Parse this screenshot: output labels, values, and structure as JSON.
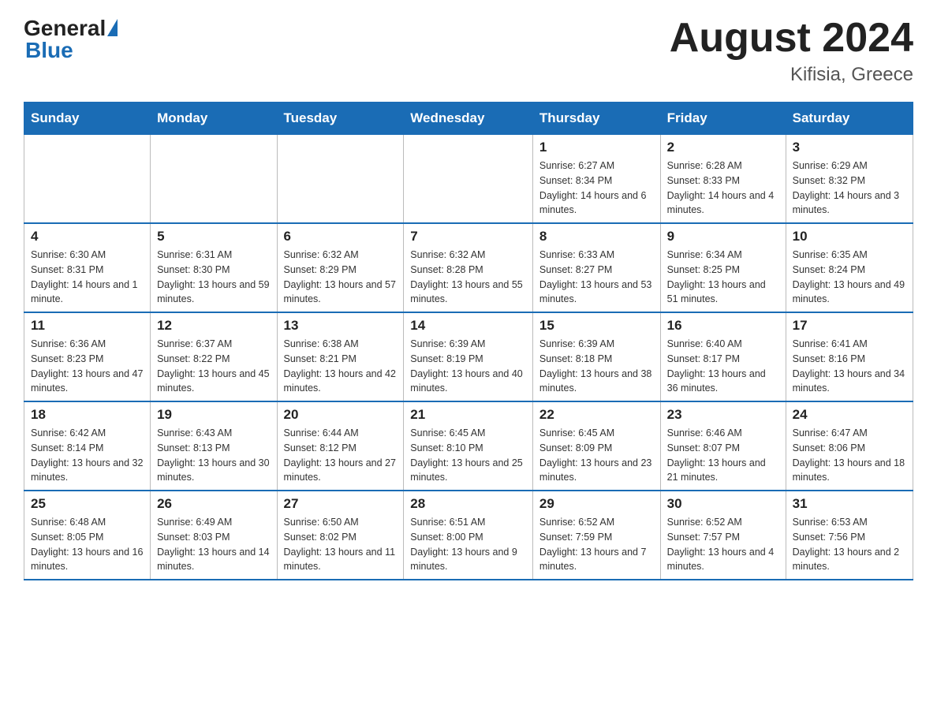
{
  "header": {
    "logo": {
      "general": "General",
      "blue": "Blue"
    },
    "title": "August 2024",
    "subtitle": "Kifisia, Greece"
  },
  "weekdays": [
    "Sunday",
    "Monday",
    "Tuesday",
    "Wednesday",
    "Thursday",
    "Friday",
    "Saturday"
  ],
  "weeks": [
    [
      {
        "day": "",
        "info": ""
      },
      {
        "day": "",
        "info": ""
      },
      {
        "day": "",
        "info": ""
      },
      {
        "day": "",
        "info": ""
      },
      {
        "day": "1",
        "info": "Sunrise: 6:27 AM\nSunset: 8:34 PM\nDaylight: 14 hours and 6 minutes."
      },
      {
        "day": "2",
        "info": "Sunrise: 6:28 AM\nSunset: 8:33 PM\nDaylight: 14 hours and 4 minutes."
      },
      {
        "day": "3",
        "info": "Sunrise: 6:29 AM\nSunset: 8:32 PM\nDaylight: 14 hours and 3 minutes."
      }
    ],
    [
      {
        "day": "4",
        "info": "Sunrise: 6:30 AM\nSunset: 8:31 PM\nDaylight: 14 hours and 1 minute."
      },
      {
        "day": "5",
        "info": "Sunrise: 6:31 AM\nSunset: 8:30 PM\nDaylight: 13 hours and 59 minutes."
      },
      {
        "day": "6",
        "info": "Sunrise: 6:32 AM\nSunset: 8:29 PM\nDaylight: 13 hours and 57 minutes."
      },
      {
        "day": "7",
        "info": "Sunrise: 6:32 AM\nSunset: 8:28 PM\nDaylight: 13 hours and 55 minutes."
      },
      {
        "day": "8",
        "info": "Sunrise: 6:33 AM\nSunset: 8:27 PM\nDaylight: 13 hours and 53 minutes."
      },
      {
        "day": "9",
        "info": "Sunrise: 6:34 AM\nSunset: 8:25 PM\nDaylight: 13 hours and 51 minutes."
      },
      {
        "day": "10",
        "info": "Sunrise: 6:35 AM\nSunset: 8:24 PM\nDaylight: 13 hours and 49 minutes."
      }
    ],
    [
      {
        "day": "11",
        "info": "Sunrise: 6:36 AM\nSunset: 8:23 PM\nDaylight: 13 hours and 47 minutes."
      },
      {
        "day": "12",
        "info": "Sunrise: 6:37 AM\nSunset: 8:22 PM\nDaylight: 13 hours and 45 minutes."
      },
      {
        "day": "13",
        "info": "Sunrise: 6:38 AM\nSunset: 8:21 PM\nDaylight: 13 hours and 42 minutes."
      },
      {
        "day": "14",
        "info": "Sunrise: 6:39 AM\nSunset: 8:19 PM\nDaylight: 13 hours and 40 minutes."
      },
      {
        "day": "15",
        "info": "Sunrise: 6:39 AM\nSunset: 8:18 PM\nDaylight: 13 hours and 38 minutes."
      },
      {
        "day": "16",
        "info": "Sunrise: 6:40 AM\nSunset: 8:17 PM\nDaylight: 13 hours and 36 minutes."
      },
      {
        "day": "17",
        "info": "Sunrise: 6:41 AM\nSunset: 8:16 PM\nDaylight: 13 hours and 34 minutes."
      }
    ],
    [
      {
        "day": "18",
        "info": "Sunrise: 6:42 AM\nSunset: 8:14 PM\nDaylight: 13 hours and 32 minutes."
      },
      {
        "day": "19",
        "info": "Sunrise: 6:43 AM\nSunset: 8:13 PM\nDaylight: 13 hours and 30 minutes."
      },
      {
        "day": "20",
        "info": "Sunrise: 6:44 AM\nSunset: 8:12 PM\nDaylight: 13 hours and 27 minutes."
      },
      {
        "day": "21",
        "info": "Sunrise: 6:45 AM\nSunset: 8:10 PM\nDaylight: 13 hours and 25 minutes."
      },
      {
        "day": "22",
        "info": "Sunrise: 6:45 AM\nSunset: 8:09 PM\nDaylight: 13 hours and 23 minutes."
      },
      {
        "day": "23",
        "info": "Sunrise: 6:46 AM\nSunset: 8:07 PM\nDaylight: 13 hours and 21 minutes."
      },
      {
        "day": "24",
        "info": "Sunrise: 6:47 AM\nSunset: 8:06 PM\nDaylight: 13 hours and 18 minutes."
      }
    ],
    [
      {
        "day": "25",
        "info": "Sunrise: 6:48 AM\nSunset: 8:05 PM\nDaylight: 13 hours and 16 minutes."
      },
      {
        "day": "26",
        "info": "Sunrise: 6:49 AM\nSunset: 8:03 PM\nDaylight: 13 hours and 14 minutes."
      },
      {
        "day": "27",
        "info": "Sunrise: 6:50 AM\nSunset: 8:02 PM\nDaylight: 13 hours and 11 minutes."
      },
      {
        "day": "28",
        "info": "Sunrise: 6:51 AM\nSunset: 8:00 PM\nDaylight: 13 hours and 9 minutes."
      },
      {
        "day": "29",
        "info": "Sunrise: 6:52 AM\nSunset: 7:59 PM\nDaylight: 13 hours and 7 minutes."
      },
      {
        "day": "30",
        "info": "Sunrise: 6:52 AM\nSunset: 7:57 PM\nDaylight: 13 hours and 4 minutes."
      },
      {
        "day": "31",
        "info": "Sunrise: 6:53 AM\nSunset: 7:56 PM\nDaylight: 13 hours and 2 minutes."
      }
    ]
  ]
}
